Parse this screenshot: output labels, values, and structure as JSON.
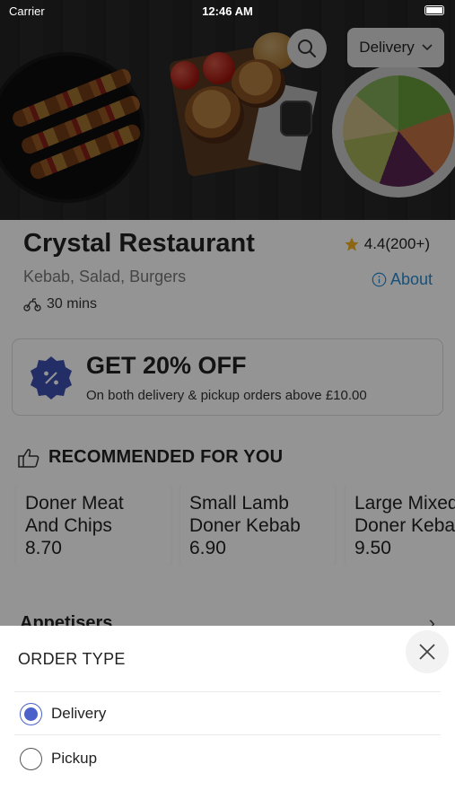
{
  "status_bar": {
    "carrier": "Carrier",
    "time": "12:46 AM"
  },
  "header": {
    "order_type_selected": "Delivery"
  },
  "restaurant": {
    "name": "Crystal Restaurant",
    "rating": "4.4(200+)",
    "cuisine": "Kebab, Salad, Burgers",
    "about_label": "About",
    "eta": "30 mins"
  },
  "offer": {
    "title": "GET 20% OFF",
    "subtitle": "On both delivery & pickup orders above £10.00"
  },
  "recommended": {
    "heading": "RECOMMENDED FOR YOU",
    "items": [
      {
        "name": "Doner Meat\nAnd Chips",
        "price": "8.70"
      },
      {
        "name": "Small Lamb\nDoner Kebab",
        "price": "6.90"
      },
      {
        "name": "Large Mixed\nDoner Kebab",
        "price": "9.50"
      }
    ]
  },
  "menu_section": {
    "label": "Appetisers"
  },
  "order_sheet": {
    "title": "ORDER TYPE",
    "options": [
      {
        "label": "Delivery",
        "selected": true
      },
      {
        "label": "Pickup",
        "selected": false
      }
    ]
  },
  "colors": {
    "accent": "#4a62c9",
    "link": "#2a8bd1",
    "star": "#f2b01e",
    "badge": "#3d4fb0"
  },
  "icons": [
    "search-icon",
    "chevron-down-icon",
    "star-icon",
    "info-icon",
    "scooter-icon",
    "percent-badge-icon",
    "thumbs-up-icon",
    "chevron-right-icon",
    "close-icon"
  ]
}
